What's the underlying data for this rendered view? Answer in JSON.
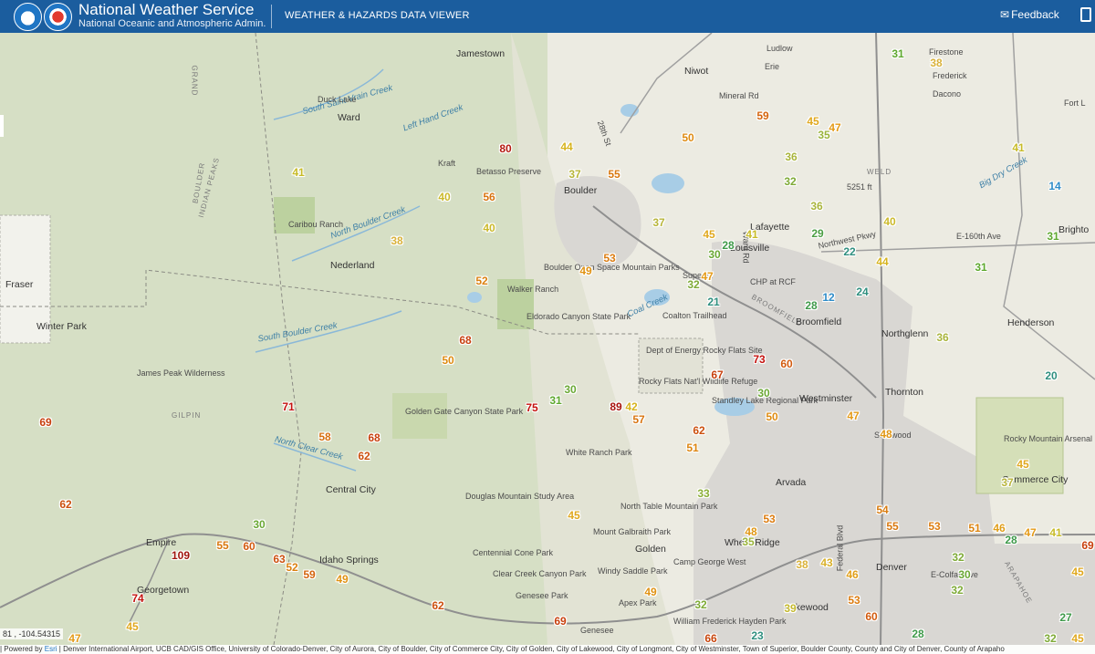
{
  "header": {
    "title": "National Weather Service",
    "subtitle": "National Oceanic and Atmospheric Admin.",
    "viewer_title": "WEATHER & HAZARDS DATA VIEWER",
    "feedback_label": "Feedback"
  },
  "map": {
    "coordinates": "81 , -104.54315",
    "attribution": {
      "powered_by": "| Powered by",
      "esri": "Esri",
      "sources": "| Denver International Airport, UCB CAD/GIS Office, University of Colorado-Denver, City of Aurora, City of Boulder, City of Commerce City, City of Golden, City of Lakewood, City of Longmont, City of Westminster, Town of Superior, Boulder County, County and City of Denver, County of Arapaho"
    },
    "labels": [
      {
        "text": "Jamestown",
        "type": "city"
      },
      {
        "text": "South Saint Vrain Creek",
        "type": "water"
      },
      {
        "text": "Duck Lake",
        "type": "small"
      },
      {
        "text": "Ward",
        "type": "city"
      },
      {
        "text": "Left Hand Creek",
        "type": "water"
      },
      {
        "text": "Kraft",
        "type": "small"
      },
      {
        "text": "Betasso Preserve",
        "type": "small"
      },
      {
        "text": "Boulder",
        "type": "city"
      },
      {
        "text": "28th St",
        "type": "small"
      },
      {
        "text": "Caribou Ranch",
        "type": "small"
      },
      {
        "text": "North Boulder Creek",
        "type": "water"
      },
      {
        "text": "Nederland",
        "type": "city"
      },
      {
        "text": "Fraser",
        "type": "city"
      },
      {
        "text": "Winter Park",
        "type": "city"
      },
      {
        "text": "South Boulder Creek",
        "type": "water"
      },
      {
        "text": "Walker Ranch",
        "type": "small"
      },
      {
        "text": "Boulder Open Space Mountain Parks",
        "type": "small"
      },
      {
        "text": "Eldorado Canyon State Park",
        "type": "small"
      },
      {
        "text": "Coal Creek",
        "type": "water"
      },
      {
        "text": "Coalton Trailhead",
        "type": "small"
      },
      {
        "text": "James Peak Wilderness",
        "type": "small"
      },
      {
        "text": "GILPIN",
        "type": "peak"
      },
      {
        "text": "Golden Gate Canyon State Park",
        "type": "small"
      },
      {
        "text": "North Clear Creek",
        "type": "water"
      },
      {
        "text": "Central City",
        "type": "city"
      },
      {
        "text": "Dept of Energy Rocky Flats Site",
        "type": "small"
      },
      {
        "text": "Rocky Flats Nat'l Wildlife Refuge",
        "type": "small"
      },
      {
        "text": "Standley Lake Regional Park",
        "type": "small"
      },
      {
        "text": "White Ranch Park",
        "type": "small"
      },
      {
        "text": "Douglas Mountain Study Area",
        "type": "small"
      },
      {
        "text": "North Table Mountain Park",
        "type": "small"
      },
      {
        "text": "Mount Galbraith Park",
        "type": "small"
      },
      {
        "text": "Golden",
        "type": "city"
      },
      {
        "text": "Centennial Cone Park",
        "type": "small"
      },
      {
        "text": "Clear Creek Canyon Park",
        "type": "small"
      },
      {
        "text": "Empire",
        "type": "city"
      },
      {
        "text": "Idaho Springs",
        "type": "city"
      },
      {
        "text": "Georgetown",
        "type": "city"
      },
      {
        "text": "Genesee Park",
        "type": "small"
      },
      {
        "text": "Windy Saddle Park",
        "type": "small"
      },
      {
        "text": "Apex Park",
        "type": "small"
      },
      {
        "text": "Camp George West",
        "type": "small"
      },
      {
        "text": "Genesee",
        "type": "small"
      },
      {
        "text": "William Frederick Hayden Park",
        "type": "small"
      },
      {
        "text": "Niwot",
        "type": "city"
      },
      {
        "text": "Mineral Rd",
        "type": "small"
      },
      {
        "text": "Ludlow",
        "type": "small"
      },
      {
        "text": "Erie",
        "type": "small"
      },
      {
        "text": "Firestone",
        "type": "small"
      },
      {
        "text": "Frederick",
        "type": "small"
      },
      {
        "text": "Dacono",
        "type": "small"
      },
      {
        "text": "Fort L",
        "type": "small"
      },
      {
        "text": "WELD",
        "type": "peak"
      },
      {
        "text": "Big Dry Creek",
        "type": "water"
      },
      {
        "text": "Lafayette",
        "type": "city"
      },
      {
        "text": "Louisville",
        "type": "city"
      },
      {
        "text": "Superior",
        "type": "small"
      },
      {
        "text": "CHP at RCF",
        "type": "small"
      },
      {
        "text": "BROOMFIELD",
        "type": "peak"
      },
      {
        "text": "Broomfield",
        "type": "city"
      },
      {
        "text": "Northwest Pkwy",
        "type": "small"
      },
      {
        "text": "E-160th Ave",
        "type": "small"
      },
      {
        "text": "Brighto",
        "type": "city"
      },
      {
        "text": "Northglenn",
        "type": "city"
      },
      {
        "text": "Henderson",
        "type": "city"
      },
      {
        "text": "Westminster",
        "type": "city"
      },
      {
        "text": "Thornton",
        "type": "city"
      },
      {
        "text": "Shérwood",
        "type": "small"
      },
      {
        "text": "Rocky Mountain Arsenal Nat'l Refuge",
        "type": "small"
      },
      {
        "text": "Commerce City",
        "type": "city"
      },
      {
        "text": "Arvada",
        "type": "city"
      },
      {
        "text": "Wheat Ridge",
        "type": "city"
      },
      {
        "text": "Denver",
        "type": "city"
      },
      {
        "text": "Lakewood",
        "type": "city"
      },
      {
        "text": "E-Colfax Ave",
        "type": "small"
      },
      {
        "text": "ARAPAHOE",
        "type": "peak"
      },
      {
        "text": "Federal Blvd",
        "type": "small"
      },
      {
        "text": "5251 ft",
        "type": "small"
      },
      {
        "text": "INDIAN PEAKS",
        "type": "peak"
      },
      {
        "text": "BOULDER",
        "type": "peak"
      },
      {
        "text": "GRAND",
        "type": "peak"
      },
      {
        "text": "Ward Rd",
        "type": "small"
      }
    ],
    "readings": [
      {
        "v": "31",
        "c": "#5ea82e"
      },
      {
        "v": "38",
        "c": "#d9b23b"
      },
      {
        "v": "45",
        "c": "#e0a81e"
      },
      {
        "v": "47",
        "c": "#e49a16"
      },
      {
        "v": "35",
        "c": "#9ab43b"
      },
      {
        "v": "59",
        "c": "#d4640e"
      },
      {
        "v": "50",
        "c": "#de8b12"
      },
      {
        "v": "44",
        "c": "#d6b31d"
      },
      {
        "v": "41",
        "c": "#c7bb27"
      },
      {
        "v": "80",
        "c": "#b51a10"
      },
      {
        "v": "36",
        "c": "#a9b43b"
      },
      {
        "v": "41",
        "c": "#c7bb27"
      },
      {
        "v": "14",
        "c": "#2f8cc8"
      },
      {
        "v": "37",
        "c": "#b8b53a"
      },
      {
        "v": "55",
        "c": "#d87810"
      },
      {
        "v": "32",
        "c": "#7eaa36"
      },
      {
        "v": "40",
        "c": "#cbb92a"
      },
      {
        "v": "56",
        "c": "#d87410"
      },
      {
        "v": "36",
        "c": "#a9b43b"
      },
      {
        "v": "40",
        "c": "#cbb92a"
      },
      {
        "v": "37",
        "c": "#b8b53a"
      },
      {
        "v": "45",
        "c": "#e0a81e"
      },
      {
        "v": "41",
        "c": "#c7bb27"
      },
      {
        "v": "28",
        "c": "#3f9a4a"
      },
      {
        "v": "29",
        "c": "#4b9e43"
      },
      {
        "v": "40",
        "c": "#cbb92a"
      },
      {
        "v": "31",
        "c": "#5ea82e"
      },
      {
        "v": "38",
        "c": "#d9b23b"
      },
      {
        "v": "22",
        "c": "#2f8f7f"
      },
      {
        "v": "53",
        "c": "#dc7c10"
      },
      {
        "v": "30",
        "c": "#6aa834"
      },
      {
        "v": "44",
        "c": "#d6b31d"
      },
      {
        "v": "31",
        "c": "#5ea82e"
      },
      {
        "v": "49",
        "c": "#e09212"
      },
      {
        "v": "47",
        "c": "#e49a16"
      },
      {
        "v": "52",
        "c": "#db8010"
      },
      {
        "v": "32",
        "c": "#7eaa36"
      },
      {
        "v": "24",
        "c": "#2f8f7f"
      },
      {
        "v": "21",
        "c": "#2f8f7f"
      },
      {
        "v": "12",
        "c": "#2f8cc8"
      },
      {
        "v": "28",
        "c": "#3f9a4a"
      },
      {
        "v": "36",
        "c": "#a9b43b"
      },
      {
        "v": "68",
        "c": "#c8400e"
      },
      {
        "v": "50",
        "c": "#de8b12"
      },
      {
        "v": "73",
        "c": "#c4120e"
      },
      {
        "v": "60",
        "c": "#d25a0e"
      },
      {
        "v": "20",
        "c": "#2f8f7f"
      },
      {
        "v": "67",
        "c": "#c8400e"
      },
      {
        "v": "69",
        "c": "#c8400e"
      },
      {
        "v": "71",
        "c": "#c4120e"
      },
      {
        "v": "75",
        "c": "#c4120e"
      },
      {
        "v": "31",
        "c": "#5ea82e"
      },
      {
        "v": "30",
        "c": "#6aa834"
      },
      {
        "v": "89",
        "c": "#a8140e"
      },
      {
        "v": "42",
        "c": "#d6b31d"
      },
      {
        "v": "57",
        "c": "#d87410"
      },
      {
        "v": "30",
        "c": "#6aa834"
      },
      {
        "v": "50",
        "c": "#de8b12"
      },
      {
        "v": "47",
        "c": "#e49a16"
      },
      {
        "v": "58",
        "c": "#d67010"
      },
      {
        "v": "68",
        "c": "#c8400e"
      },
      {
        "v": "62",
        "c": "#cc500e"
      },
      {
        "v": "48",
        "c": "#e09614"
      },
      {
        "v": "62",
        "c": "#cc500e"
      },
      {
        "v": "51",
        "c": "#dc8410"
      },
      {
        "v": "45",
        "c": "#e0a81e"
      },
      {
        "v": "37",
        "c": "#b8b53a"
      },
      {
        "v": "62",
        "c": "#cc500e"
      },
      {
        "v": "33",
        "c": "#8aae37"
      },
      {
        "v": "45",
        "c": "#e0a81e"
      },
      {
        "v": "30",
        "c": "#6aa834"
      },
      {
        "v": "53",
        "c": "#dc7c10"
      },
      {
        "v": "54",
        "c": "#d87c10"
      },
      {
        "v": "55",
        "c": "#d87810"
      },
      {
        "v": "53",
        "c": "#dc7c10"
      },
      {
        "v": "51",
        "c": "#dc8410"
      },
      {
        "v": "46",
        "c": "#e09e18"
      },
      {
        "v": "47",
        "c": "#e49a16"
      },
      {
        "v": "41",
        "c": "#c7bb27"
      },
      {
        "v": "28",
        "c": "#3f9a4a"
      },
      {
        "v": "48",
        "c": "#e09614"
      },
      {
        "v": "35",
        "c": "#9ab43b"
      },
      {
        "v": "109",
        "c": "#a0140e"
      },
      {
        "v": "55",
        "c": "#d87810"
      },
      {
        "v": "60",
        "c": "#d25a0e"
      },
      {
        "v": "63",
        "c": "#cc500e"
      },
      {
        "v": "52",
        "c": "#db8010"
      },
      {
        "v": "59",
        "c": "#d4640e"
      },
      {
        "v": "49",
        "c": "#e09212"
      },
      {
        "v": "38",
        "c": "#d9b23b"
      },
      {
        "v": "43",
        "c": "#d9b02a"
      },
      {
        "v": "46",
        "c": "#e09e18"
      },
      {
        "v": "32",
        "c": "#7eaa36"
      },
      {
        "v": "30",
        "c": "#6aa834"
      },
      {
        "v": "45",
        "c": "#e0a81e"
      },
      {
        "v": "74",
        "c": "#c4120e"
      },
      {
        "v": "62",
        "c": "#cc500e"
      },
      {
        "v": "69",
        "c": "#c8400e"
      },
      {
        "v": "49",
        "c": "#e09212"
      },
      {
        "v": "32",
        "c": "#7eaa36"
      },
      {
        "v": "39",
        "c": "#c4b92e"
      },
      {
        "v": "53",
        "c": "#dc7c10"
      },
      {
        "v": "60",
        "c": "#d25a0e"
      },
      {
        "v": "45",
        "c": "#e0a81e"
      },
      {
        "v": "47",
        "c": "#e49a16"
      },
      {
        "v": "66",
        "c": "#c8460e"
      },
      {
        "v": "23",
        "c": "#2f8f7f"
      },
      {
        "v": "28",
        "c": "#3f9a4a"
      },
      {
        "v": "32",
        "c": "#7eaa36"
      },
      {
        "v": "27",
        "c": "#3f9a4a"
      },
      {
        "v": "32",
        "c": "#7eaa36"
      },
      {
        "v": "45",
        "c": "#e0a81e"
      },
      {
        "v": "69",
        "c": "#c8400e"
      }
    ]
  }
}
